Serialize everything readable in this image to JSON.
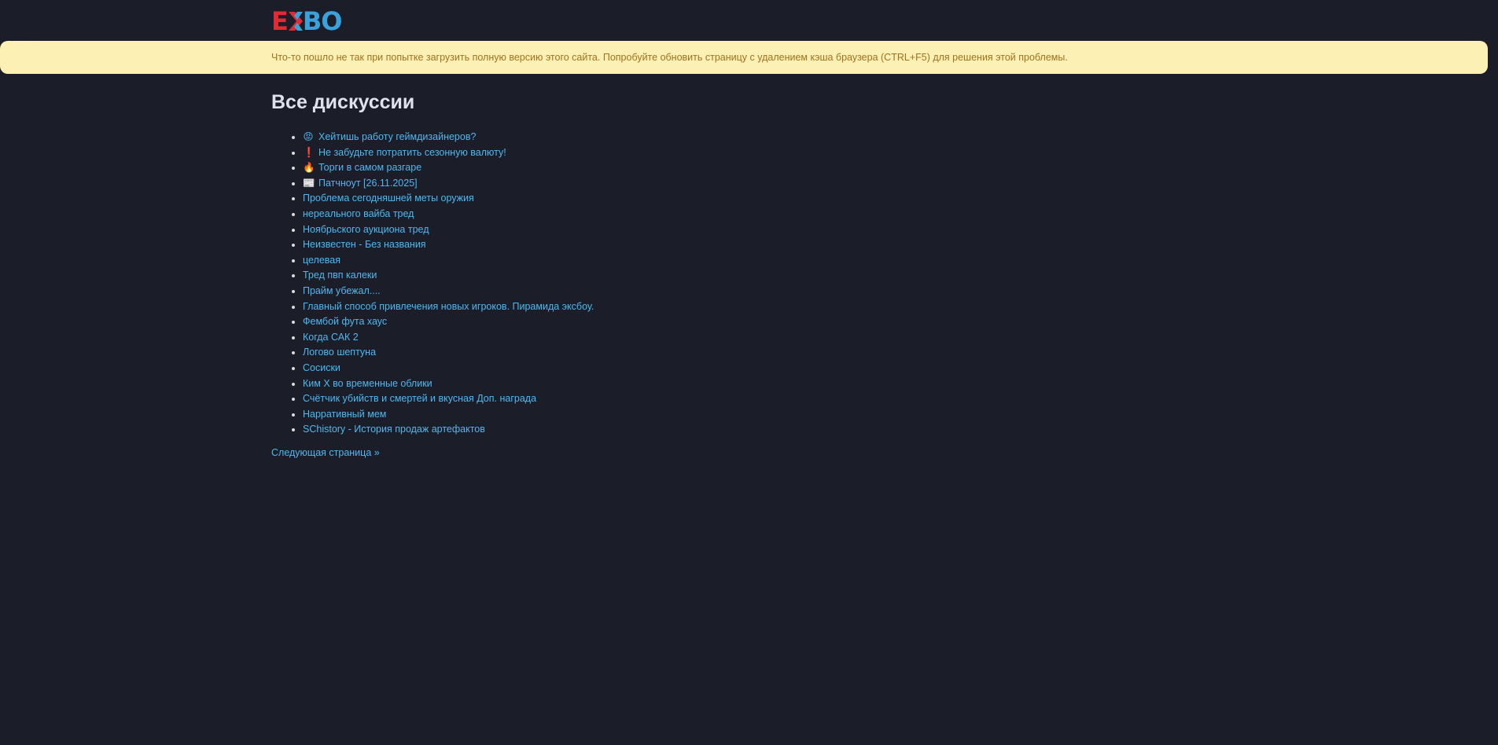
{
  "header": {
    "logo": {
      "part1": "E",
      "part2": "BO"
    }
  },
  "alert": {
    "text": "Что-то пошло не так при попытке загрузить полную версию этого сайта. Попробуйте обновить страницу с удалением кэша браузера (CTRL+F5) для решения этой проблемы."
  },
  "main": {
    "title": "Все дискуссии",
    "discussions": [
      {
        "emoji": "😡",
        "title": "Хейтишь работу геймдизайнеров?"
      },
      {
        "emoji": "❗",
        "title": "Не забудьте потратить сезонную валюту!"
      },
      {
        "emoji": "🔥",
        "title": "Торги в самом разгаре"
      },
      {
        "emoji": "📰",
        "title": "Патчноут [26.11.2025]"
      },
      {
        "emoji": "",
        "title": "Проблема сегодняшней меты оружия"
      },
      {
        "emoji": "",
        "title": "нереального вайба тред"
      },
      {
        "emoji": "",
        "title": "Ноябрьского аукциона тред"
      },
      {
        "emoji": "",
        "title": "Неизвестен - Без названия"
      },
      {
        "emoji": "",
        "title": "целевая"
      },
      {
        "emoji": "",
        "title": "Тред пвп калеки"
      },
      {
        "emoji": "",
        "title": "Прайм убежал...."
      },
      {
        "emoji": "",
        "title": "Главный способ привлечения новых игроков. Пирамида эксбоу."
      },
      {
        "emoji": "",
        "title": "Фембой фута хаус"
      },
      {
        "emoji": "",
        "title": "Когда САК 2"
      },
      {
        "emoji": "",
        "title": "Логово шептуна"
      },
      {
        "emoji": "",
        "title": "Сосиски"
      },
      {
        "emoji": "",
        "title": "Ким Х во временные облики"
      },
      {
        "emoji": "",
        "title": "Счётчик убийств и смертей и вкусная Доп. награда"
      },
      {
        "emoji": "",
        "title": "Нарративный мем"
      },
      {
        "emoji": "",
        "title": "SChistory - История продаж артефактов"
      }
    ],
    "next_page": "Следующая страница »"
  },
  "colors": {
    "background": "#1b1d28",
    "alert_bg": "#fdf0b4",
    "alert_text": "#a0711c",
    "link": "#4fb8f0",
    "logo_red": "#e12a33",
    "logo_blue": "#3aa1dc"
  }
}
